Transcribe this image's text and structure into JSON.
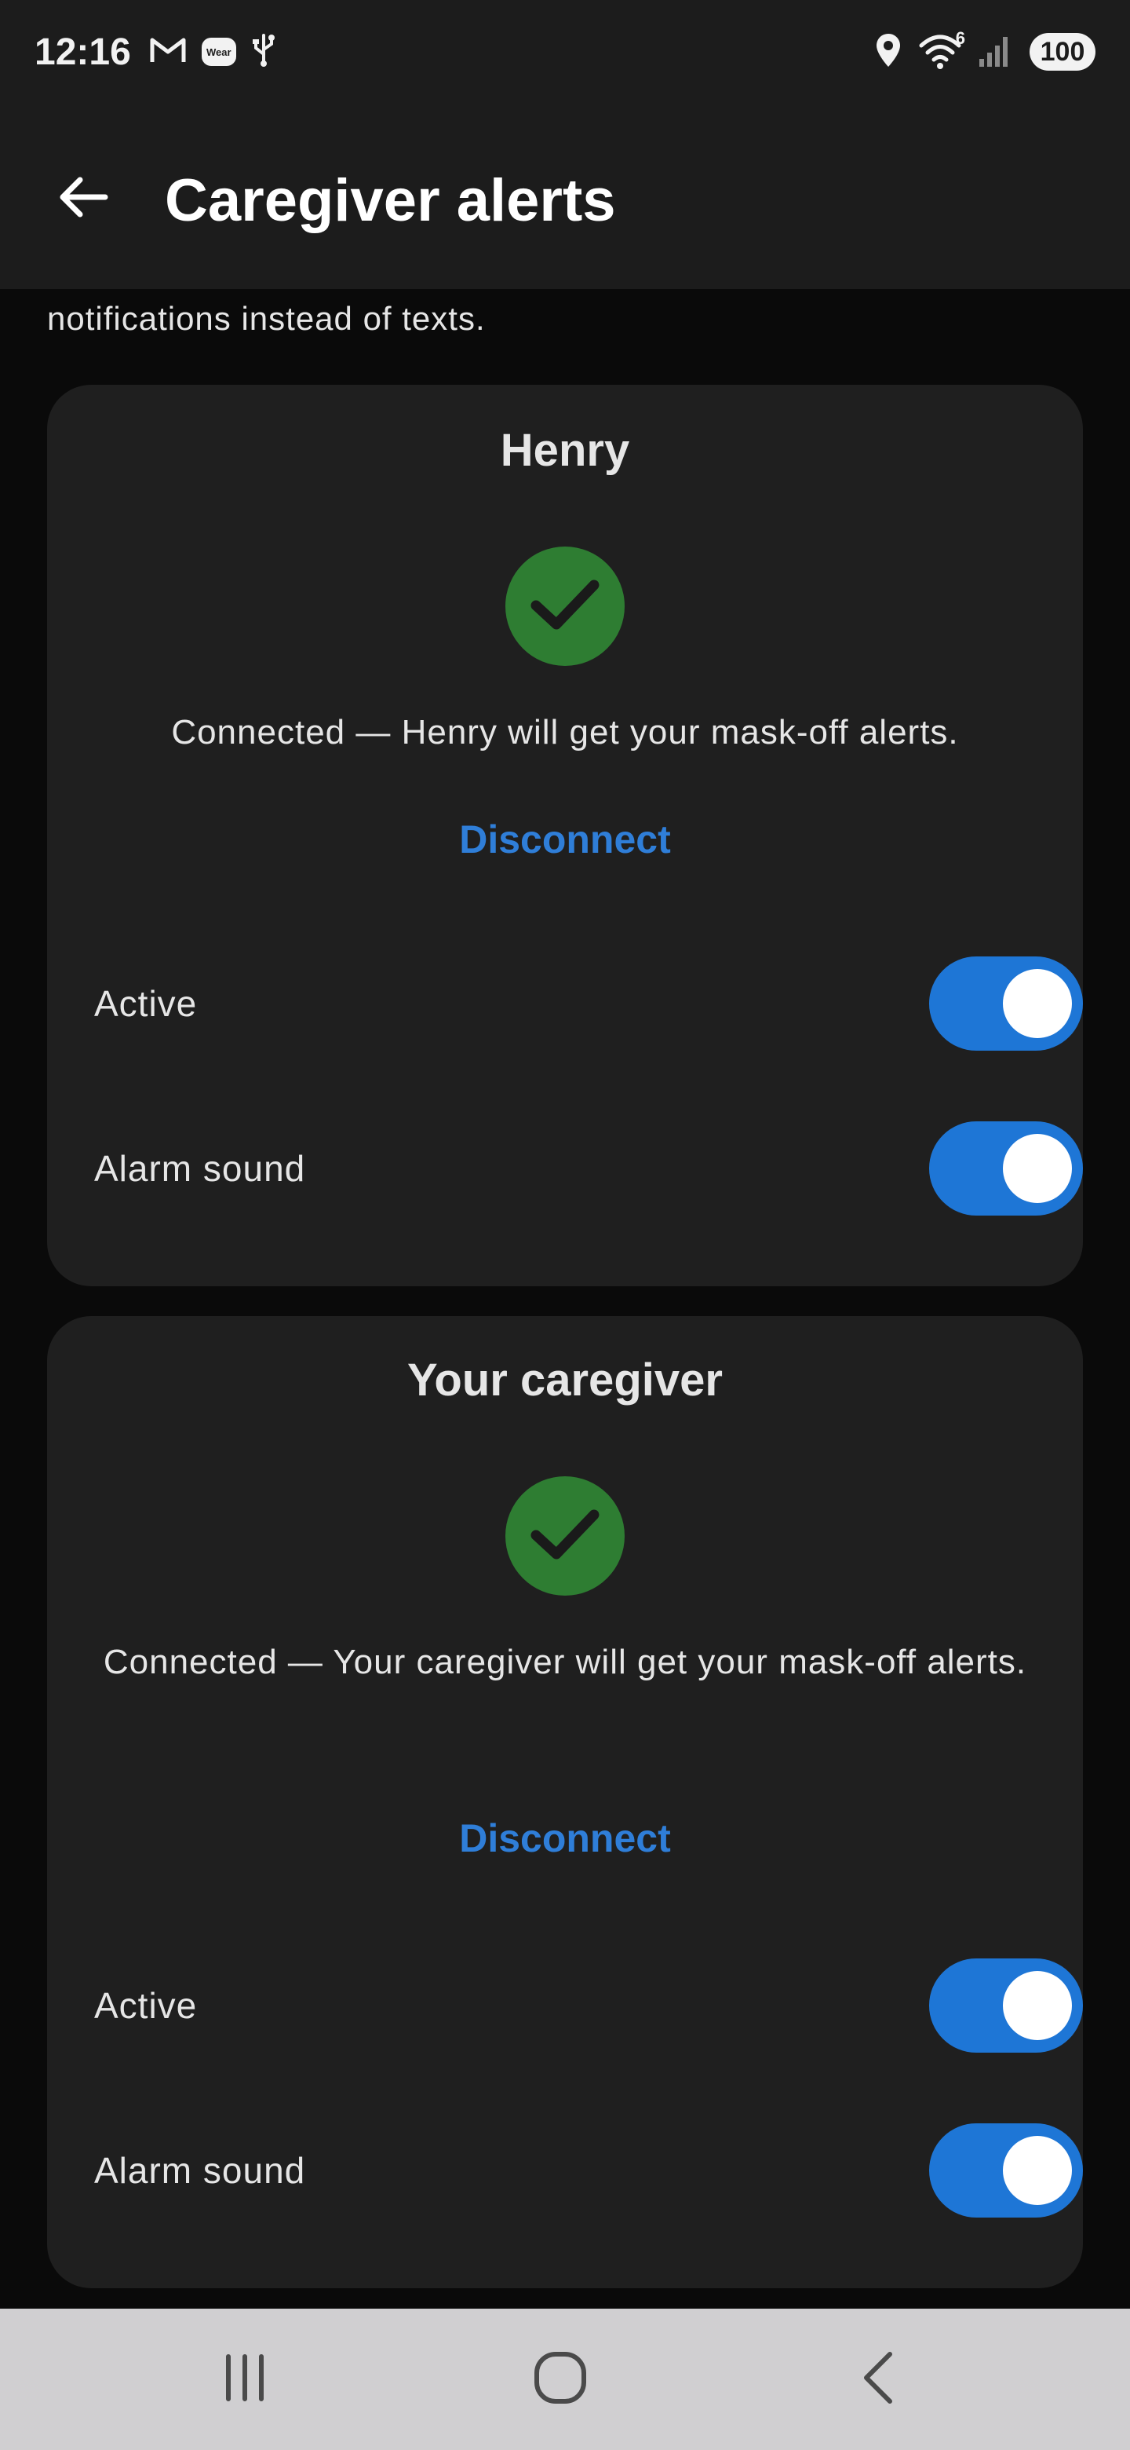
{
  "status_bar": {
    "time": "12:16",
    "wear_label": "Wear",
    "wifi_badge": "6",
    "battery": "100",
    "icons": [
      "gmail-icon",
      "wear-icon",
      "usb-icon",
      "location-icon",
      "wifi-icon",
      "signal-icon",
      "battery-icon"
    ]
  },
  "app_bar": {
    "title": "Caregiver alerts",
    "back_icon": "arrow-left-icon"
  },
  "intro": {
    "text": "notifications instead of texts."
  },
  "cards": [
    {
      "name": "Henry",
      "status_icon": "check-icon",
      "status_text": "Connected — Henry will get your mask-off alerts.",
      "disconnect_label": "Disconnect",
      "toggles": [
        {
          "label": "Active",
          "on": true
        },
        {
          "label": "Alarm sound",
          "on": true
        }
      ]
    },
    {
      "name": "Your caregiver",
      "status_icon": "check-icon",
      "status_text": "Connected — Your caregiver will get your mask-off alerts.",
      "disconnect_label": "Disconnect",
      "toggles": [
        {
          "label": "Active",
          "on": true
        },
        {
          "label": "Alarm sound",
          "on": true
        }
      ]
    }
  ],
  "nav_bar": {
    "icons": [
      "recents-icon",
      "home-icon",
      "back-icon"
    ]
  },
  "colors": {
    "accent": "#1e76d6",
    "link": "#2f7ed8",
    "success": "#2e7d32",
    "card": "#1f1f1f",
    "background": "#0a0a0a"
  }
}
